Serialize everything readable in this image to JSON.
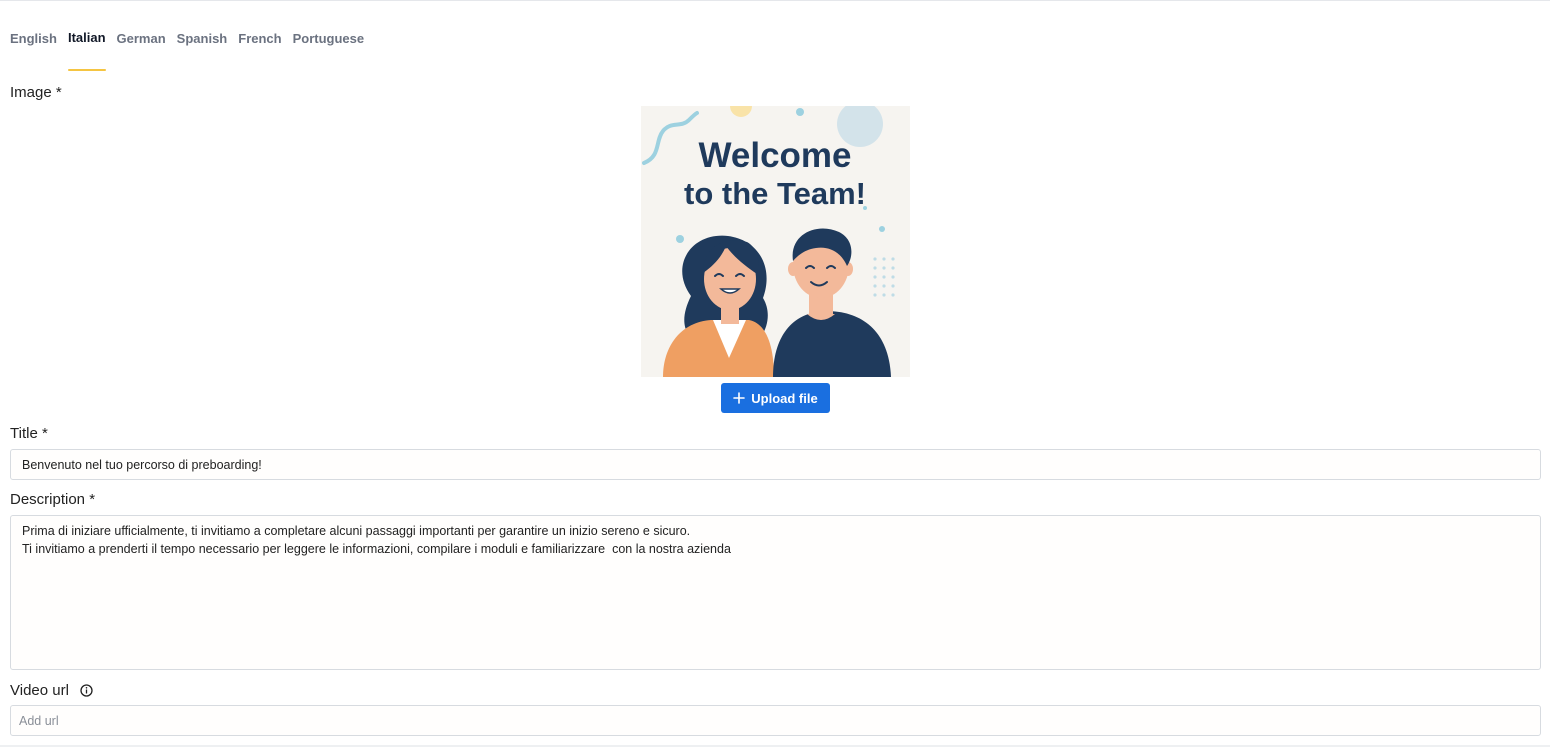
{
  "tabs": [
    {
      "label": "English",
      "active": false
    },
    {
      "label": "Italian",
      "active": true
    },
    {
      "label": "German",
      "active": false
    },
    {
      "label": "Spanish",
      "active": false
    },
    {
      "label": "French",
      "active": false
    },
    {
      "label": "Portuguese",
      "active": false
    }
  ],
  "image_field": {
    "label": "Image *",
    "preview": {
      "line1": "Welcome",
      "line2": "to the Team!"
    },
    "upload_label": "Upload file"
  },
  "title_field": {
    "label": "Title *",
    "value": "Benvenuto nel tuo percorso di preboarding!"
  },
  "description_field": {
    "label": "Description *",
    "value": "Prima di iniziare ufficialmente, ti invitiamo a completare alcuni passaggi importanti per garantire un inizio sereno e sicuro.\nTi invitiamo a prenderti il tempo necessario per leggere le informazioni, compilare i moduli e familiarizzare  con la nostra azienda"
  },
  "video_field": {
    "label": "Video url",
    "placeholder": "Add url",
    "value": ""
  },
  "colors": {
    "accent": "#1a6fe0",
    "tab_indicator": "#f5c542",
    "navy": "#1f3a5c"
  }
}
